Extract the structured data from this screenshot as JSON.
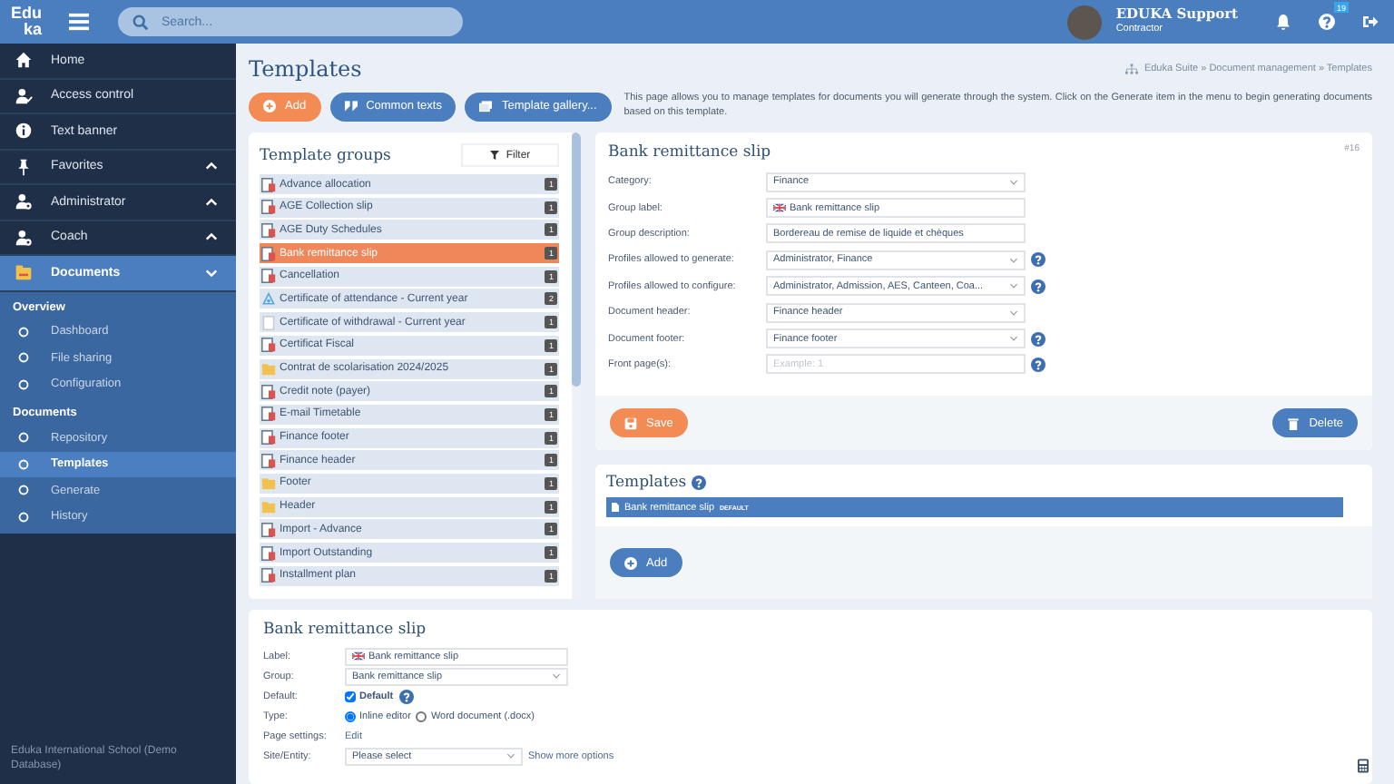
{
  "topbar": {
    "logo_top": "Edu",
    "logo_bottom": "ka",
    "search": {
      "placeholder": "Search..."
    },
    "user": {
      "name": "EDUKA Support",
      "role": "Contractor"
    },
    "help_badge": "19"
  },
  "sidebar": {
    "items": [
      {
        "label": "Home",
        "kind": "link",
        "selected": false
      },
      {
        "label": "Access control",
        "kind": "link",
        "selected": false
      },
      {
        "label": "Text banner",
        "kind": "link",
        "selected": false
      },
      {
        "label": "Favorites",
        "kind": "group",
        "expanded": false,
        "selected": false
      },
      {
        "label": "Administrator",
        "kind": "group",
        "expanded": false,
        "selected": false
      },
      {
        "label": "Coach",
        "kind": "group",
        "expanded": false,
        "selected": false
      },
      {
        "label": "Documents",
        "kind": "group",
        "expanded": true,
        "selected": true
      }
    ],
    "sections": [
      {
        "title": "Overview",
        "items": [
          {
            "label": "Dashboard",
            "selected": false
          },
          {
            "label": "File sharing",
            "selected": false
          },
          {
            "label": "Configuration",
            "selected": false
          }
        ]
      },
      {
        "title": "Documents",
        "items": [
          {
            "label": "Repository",
            "selected": false
          },
          {
            "label": "Templates",
            "selected": true
          },
          {
            "label": "Generate",
            "selected": false
          },
          {
            "label": "History",
            "selected": false
          }
        ]
      }
    ],
    "footer": "Eduka International School (Demo Database)"
  },
  "page": {
    "title": "Templates",
    "breadcrumb": "Eduka Suite » Document management » Templates",
    "buttons": [
      {
        "label": "Add",
        "kind": "add"
      },
      {
        "label": "Common texts",
        "kind": "quote"
      },
      {
        "label": "Template gallery...",
        "kind": "gallery"
      }
    ],
    "description": "This page allows you to manage templates for documents you will generate through the system. Click on the Generate item in the menu to begin generating documents based on this template."
  },
  "groups": {
    "title": "Template groups",
    "filter": "Filter",
    "items": [
      {
        "label": "Advance allocation",
        "kind": "doc",
        "count": "1",
        "selected": false
      },
      {
        "label": "AGE Collection slip",
        "kind": "doc",
        "count": "1",
        "selected": false
      },
      {
        "label": "AGE Duty Schedules",
        "kind": "doc",
        "count": "1",
        "selected": false
      },
      {
        "label": "Bank remittance slip",
        "kind": "doc",
        "count": "1",
        "selected": true
      },
      {
        "label": "Cancellation",
        "kind": "doc",
        "count": "1",
        "selected": false
      },
      {
        "label": "Certificate of attendance - Current year",
        "kind": "cert",
        "count": "2",
        "selected": false
      },
      {
        "label": "Certificate of withdrawal - Current year",
        "kind": "blank",
        "count": "1",
        "selected": false
      },
      {
        "label": "Certificat Fiscal",
        "kind": "doc",
        "count": "1",
        "selected": false
      },
      {
        "label": "Contrat de scolarisation 2024/2025",
        "kind": "folder",
        "count": "1",
        "selected": false
      },
      {
        "label": "Credit note (payer)",
        "kind": "doc",
        "count": "1",
        "selected": false
      },
      {
        "label": "E-mail Timetable",
        "kind": "doc",
        "count": "1",
        "selected": false
      },
      {
        "label": "Finance footer",
        "kind": "doc",
        "count": "1",
        "selected": false
      },
      {
        "label": "Finance header",
        "kind": "doc",
        "count": "1",
        "selected": false
      },
      {
        "label": "Footer",
        "kind": "folder",
        "count": "1",
        "selected": false
      },
      {
        "label": "Header",
        "kind": "folder",
        "count": "1",
        "selected": false
      },
      {
        "label": "Import - Advance",
        "kind": "doc",
        "count": "1",
        "selected": false
      },
      {
        "label": "Import Outstanding",
        "kind": "doc",
        "count": "1",
        "selected": false
      },
      {
        "label": "Installment plan",
        "kind": "doc",
        "count": "1",
        "selected": false
      }
    ]
  },
  "detail": {
    "title": "Bank remittance slip",
    "id": "#16",
    "fields": [
      {
        "label": "Category:",
        "kind": "select",
        "value": "Finance",
        "help": false
      },
      {
        "label": "Group label:",
        "kind": "flag",
        "value": "Bank remittance slip",
        "help": false
      },
      {
        "label": "Group description:",
        "kind": "text",
        "value": "Bordereau de remise de liquide et chèques",
        "help": false
      },
      {
        "label": "Profiles allowed to generate:",
        "kind": "select",
        "value": "Administrator, Finance",
        "help": true
      },
      {
        "label": "Profiles allowed to configure:",
        "kind": "select",
        "value": "Administrator, Admission, AES, Canteen, Coa...",
        "help": true
      },
      {
        "label": "Document header:",
        "kind": "select",
        "value": "Finance header",
        "help": false
      },
      {
        "label": "Document footer:",
        "kind": "select",
        "value": "Finance footer",
        "help": true
      },
      {
        "label": "Front page(s):",
        "kind": "input",
        "placeholder": "Example: 1",
        "help": true
      }
    ],
    "save": "Save",
    "delete": "Delete"
  },
  "templates": {
    "title": "Templates",
    "items": [
      {
        "label": "Bank remittance slip",
        "badge": "DEFAULT",
        "selected": true
      }
    ],
    "add": "Add"
  },
  "editor": {
    "title": "Bank remittance slip",
    "label": {
      "label": "Label:",
      "value": "Bank remittance slip"
    },
    "group": {
      "label": "Group:",
      "value": "Bank remittance slip"
    },
    "default": {
      "label": "Default:",
      "text": "Default",
      "checked": true
    },
    "type": {
      "label": "Type:",
      "options": [
        {
          "label": "Inline editor",
          "selected": true
        },
        {
          "label": "Word document (.docx)",
          "selected": false
        }
      ]
    },
    "page_settings": {
      "label": "Page settings:",
      "link": "Edit"
    },
    "site": {
      "label": "Site/Entity:",
      "value": "Please select",
      "link": "Show more options"
    }
  }
}
